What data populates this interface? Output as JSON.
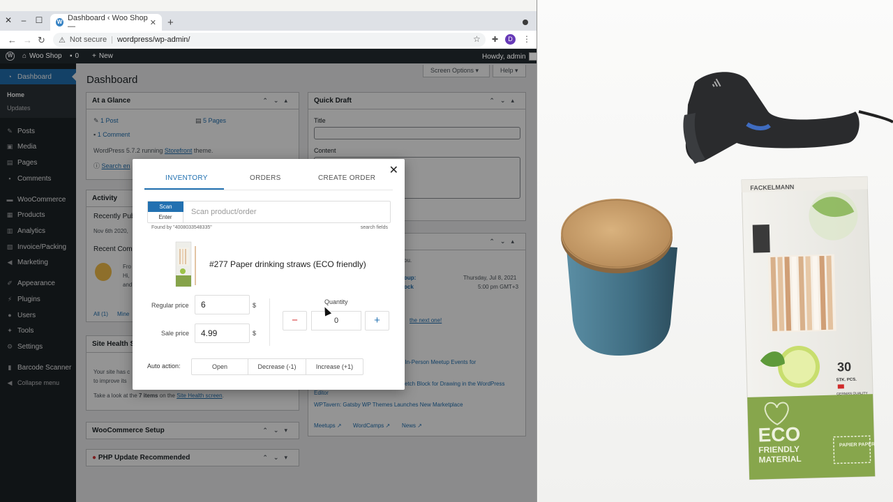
{
  "browser": {
    "tab_title": "Dashboard ‹ Woo Shop —",
    "security_label": "Not secure",
    "url": "wordpress/wp-admin/",
    "profile_initial": "D"
  },
  "adminbar": {
    "site_name": "Woo Shop",
    "comments_count": "0",
    "new_label": "New",
    "howdy": "Howdy, admin"
  },
  "sidebar": {
    "dashboard": "Dashboard",
    "home": "Home",
    "updates": "Updates",
    "items": [
      "Posts",
      "Media",
      "Pages",
      "Comments",
      "WooCommerce",
      "Products",
      "Analytics",
      "Invoice/Packing",
      "Marketing",
      "Appearance",
      "Plugins",
      "Users",
      "Tools",
      "Settings",
      "Barcode Scanner",
      "Collapse menu"
    ]
  },
  "dashboard": {
    "title": "Dashboard",
    "screen_options": "Screen Options ▾",
    "help": "Help ▾",
    "at_a_glance": {
      "title": "At a Glance",
      "posts": "1 Post",
      "pages": "5 Pages",
      "comments": "1 Comment",
      "running_prefix": "WordPress 5.7.2 running ",
      "theme": "Storefront",
      "running_suffix": " theme.",
      "search_engines": "Search en"
    },
    "activity": {
      "title": "Activity",
      "recently_published": "Recently Pub",
      "date": "Nov 6th 2020,",
      "recent_comments": "Recent Comm",
      "from": "Fro",
      "hi": "Hi,",
      "and": "and",
      "all": "All (1)",
      "mine": "Mine"
    },
    "site_health": {
      "title": "Site Health S",
      "line1": "Your site has c",
      "line2": "to improve its",
      "take_look_pre": "Take a look at the ",
      "items": "7 items",
      "take_look_mid": " on the ",
      "screen_link": "Site Health screen",
      "take_look_end": "."
    },
    "woo_setup": "WooCommerce Setup",
    "php_update": "PHP Update Recommended",
    "quick_draft": {
      "title": "Quick Draft",
      "title_label": "Title",
      "content_label": "Content"
    },
    "events": {
      "you_text": "ou.",
      "group": "oup:",
      "block": "ock",
      "date": "Thursday, Jul 8, 2021",
      "time": "5:00 pm GMT+3",
      "next_one": "the next one!",
      "news1": "ts In-Person Meetup Events for",
      "news2": "ketch Block for Drawing in the WordPress",
      "news2b": "Editor",
      "news3": "WPTavern: Gatsby WP Themes Launches New Marketplace",
      "meetups": "Meetups",
      "wordcamps": "WordCamps",
      "news": "News"
    }
  },
  "modal": {
    "tabs": [
      "INVENTORY",
      "ORDERS",
      "CREATE ORDER"
    ],
    "scan_label": "Scan",
    "enter_label": "Enter",
    "search_placeholder": "Scan product/order",
    "found_by": "Found by \"4008033548335\"",
    "search_fields": "search fields",
    "product_title": "#277 Paper drinking straws (ECO friendly)",
    "regular_price_label": "Regular price",
    "regular_price": "6",
    "sale_price_label": "Sale price",
    "sale_price": "4.99",
    "currency": "$",
    "quantity_label": "Quantity",
    "quantity": "0",
    "minus": "−",
    "plus": "+",
    "auto_action_label": "Auto action:",
    "auto_actions": [
      "Open",
      "Decrease (-1)",
      "Increase (+1)"
    ]
  },
  "photo": {
    "brand": "FACKELMANN",
    "box_lines": [
      "ECO",
      "FRIENDLY",
      "MATERIAL"
    ],
    "count": "30",
    "count_unit": "STK. PCS.",
    "quality": "GERMAN QUALITY",
    "paper": "PAPIER PAPER"
  },
  "colors": {
    "wp_dark": "#1d2327",
    "wp_blue": "#2271b1",
    "danger": "#d63638"
  }
}
